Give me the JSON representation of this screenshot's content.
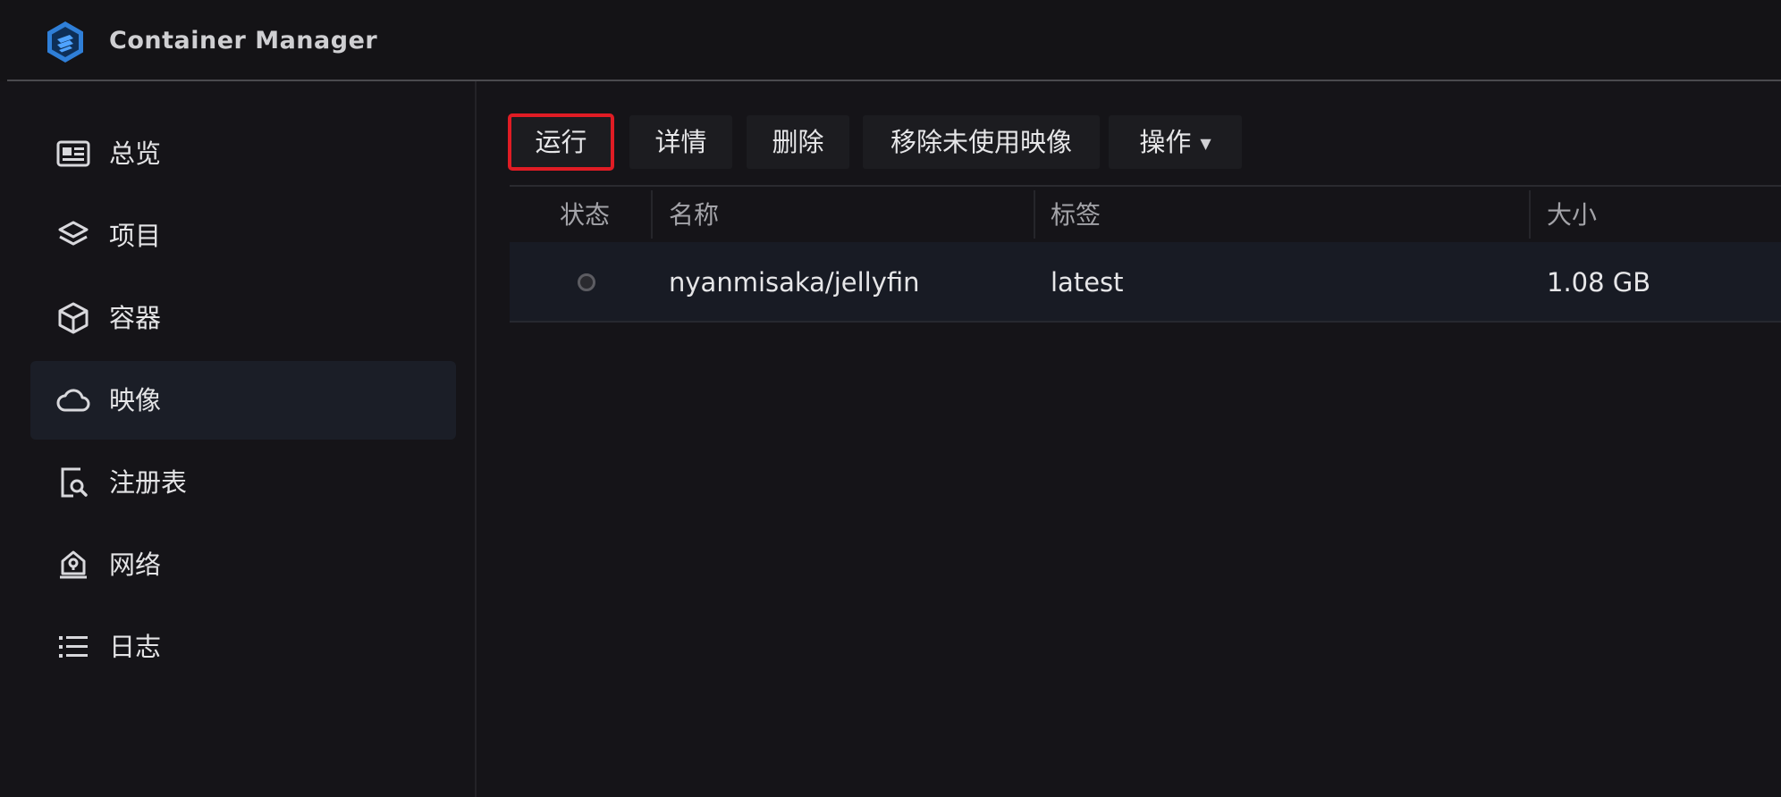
{
  "app": {
    "title": "Container Manager",
    "logo_icon": "container-manager-logo"
  },
  "sidebar": {
    "items": [
      {
        "label": "总览",
        "icon": "overview-card-icon",
        "active": false
      },
      {
        "label": "项目",
        "icon": "layers-icon",
        "active": false
      },
      {
        "label": "容器",
        "icon": "cube-icon",
        "active": false
      },
      {
        "label": "映像",
        "icon": "cloud-icon",
        "active": true
      },
      {
        "label": "注册表",
        "icon": "registry-search-icon",
        "active": false
      },
      {
        "label": "网络",
        "icon": "network-house-icon",
        "active": false
      },
      {
        "label": "日志",
        "icon": "list-icon",
        "active": false
      }
    ]
  },
  "toolbar": {
    "run_label": "运行",
    "details_label": "详情",
    "delete_label": "删除",
    "remove_unused_label": "移除未使用映像",
    "actions_label": "操作",
    "highlighted": "run"
  },
  "table": {
    "headers": {
      "status": "状态",
      "name": "名称",
      "tag": "标签",
      "size": "大小"
    },
    "rows": [
      {
        "status": "not-in-use",
        "name": "nyanmisaka/jellyfin",
        "tag": "latest",
        "size": "1.08 GB"
      }
    ]
  },
  "colors": {
    "highlight_outline": "#e01c24",
    "active_nav_bg": "#1b1e27",
    "logo_blue": "#2f7fd8"
  }
}
